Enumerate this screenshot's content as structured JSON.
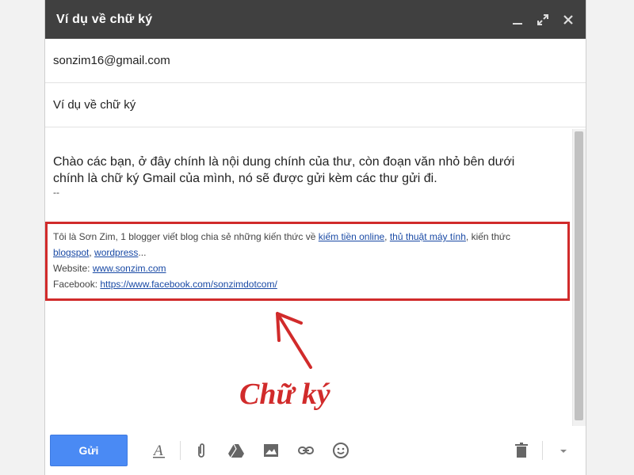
{
  "window": {
    "title": "Ví dụ về chữ ký"
  },
  "fields": {
    "to": "sonzim16@gmail.com",
    "subject": "Ví dụ về chữ ký"
  },
  "message": {
    "line1": "Chào các bạn, ở đây chính là nội dung chính của thư, còn đoạn văn nhỏ bên dưới",
    "line2": "chính là chữ ký Gmail của mình, nó sẽ được gửi kèm các thư gửi đi.",
    "dashes": "--"
  },
  "signature": {
    "intro": "Tôi là Sơn Zim, 1 blogger viết blog chia sẻ những kiến thức về ",
    "link1": "kiếm tiền online",
    "sep1": ", ",
    "link2": "thủ thuật máy tính",
    "sep2": ", kiến thức ",
    "link3": "blogspot",
    "sep3": ", ",
    "link4": "wordpress",
    "ellipsis": "...",
    "website_label": "Website: ",
    "website_link": "www.sonzim.com",
    "facebook_label": "Facebook: ",
    "facebook_link": "https://www.facebook.com/sonzimdotcom/"
  },
  "annotation": {
    "label": "Chữ ký",
    "color": "#d12b2b"
  },
  "toolbar": {
    "send_label": "Gửi",
    "icons": [
      "format-text-icon",
      "attach-icon",
      "drive-icon",
      "photo-icon",
      "link-icon",
      "emoji-icon",
      "trash-icon",
      "more-options-icon"
    ]
  },
  "colors": {
    "titlebar": "#404040",
    "send_button": "#4a8af4",
    "link": "#1a4aa5",
    "highlight_border": "#d12b2b"
  }
}
